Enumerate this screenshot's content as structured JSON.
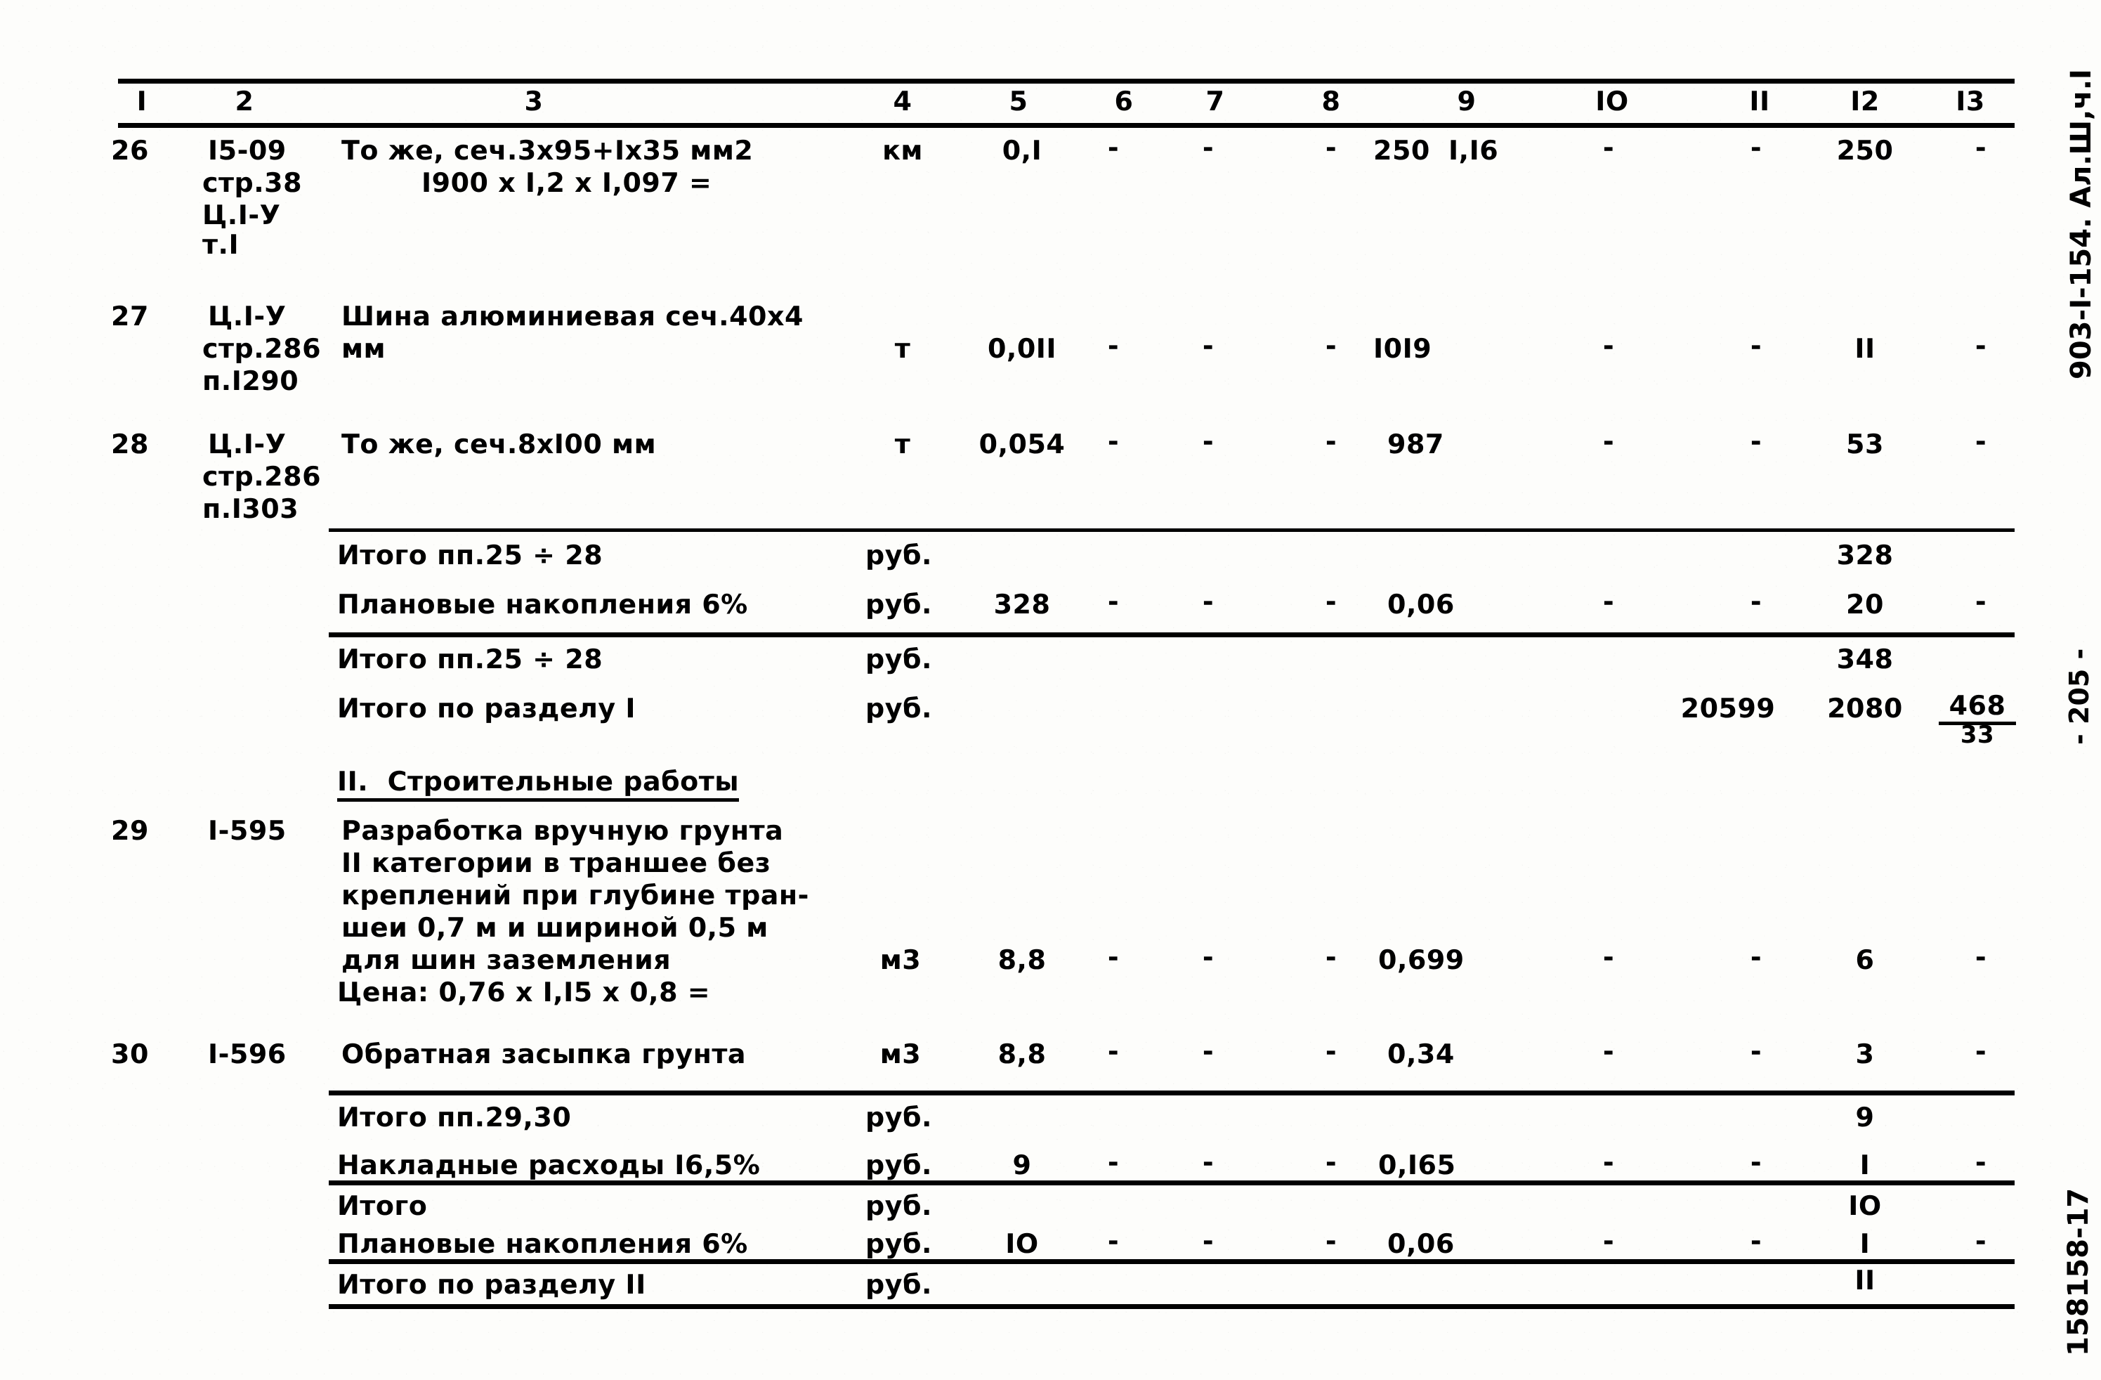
{
  "document": {
    "kind": "scanned-estimate-table",
    "language": "ru",
    "margin_marks": {
      "top_right": "903-I-154. Ал.Ш,ч.I",
      "page_number": "- 205 -",
      "bottom_right": "158158-17"
    }
  },
  "table": {
    "column_headers": [
      "I",
      "2",
      "3",
      "4",
      "5",
      "6",
      "7",
      "8",
      "9",
      "IO",
      "II",
      "I2",
      "I3"
    ],
    "rows": [
      {
        "type": "item",
        "num": "26",
        "code_lines": [
          "I5-09",
          "стр.38",
          "Ц.I-У",
          "т.I"
        ],
        "desc_lines": [
          "То же, сеч.3х95+Iх35 мм2",
          "I900 х I,2 х I,097 ="
        ],
        "unit": "км",
        "c5": "0,I",
        "c6": "-",
        "c7": "-",
        "c8": "-",
        "c9a": "250",
        "c9b": "I,I6",
        "c10": "-",
        "c11": "-",
        "c12": "250",
        "c13": "-"
      },
      {
        "type": "item",
        "num": "27",
        "code_lines": [
          "Ц.I-У",
          "стр.286",
          "п.I290"
        ],
        "desc_lines": [
          "Шина алюминиевая сеч.40х4",
          "мм"
        ],
        "unit": "т",
        "c5": "0,0II",
        "c6": "-",
        "c7": "-",
        "c8": "-",
        "c9a": "I0I9",
        "c9b": "",
        "c10": "-",
        "c11": "-",
        "c12": "II",
        "c13": "-"
      },
      {
        "type": "item",
        "num": "28",
        "code_lines": [
          "Ц.I-У",
          "стр.286",
          "п.I303"
        ],
        "desc_lines": [
          "То же, сеч.8хI00 мм"
        ],
        "unit": "т",
        "c5": "0,054",
        "c6": "-",
        "c7": "-",
        "c8": "-",
        "c9a": "987",
        "c9b": "",
        "c10": "-",
        "c11": "-",
        "c12": "53",
        "c13": "-"
      },
      {
        "type": "total",
        "label": "Итого пп.25 ÷ 28",
        "unit": "руб.",
        "c5": "",
        "c6": "",
        "c7": "",
        "c8": "",
        "c9a": "",
        "c10": "",
        "c11": "",
        "c12": "328",
        "c13": ""
      },
      {
        "type": "total",
        "label": "Плановые накопления 6%",
        "unit": "руб.",
        "c5": "328",
        "c6": "-",
        "c7": "-",
        "c8": "-",
        "c9a": "0,06",
        "c10": "-",
        "c11": "-",
        "c12": "20",
        "c13": "-"
      },
      {
        "type": "total",
        "label": "Итого пп.25 ÷ 28",
        "unit": "руб.",
        "c5": "",
        "c6": "",
        "c7": "",
        "c8": "",
        "c9a": "",
        "c10": "",
        "c11": "",
        "c12": "348",
        "c13": ""
      },
      {
        "type": "total",
        "label": "Итого по разделу I",
        "unit": "руб.",
        "c5": "",
        "c6": "",
        "c7": "",
        "c8": "",
        "c9a": "",
        "c10": "",
        "c11": "20599",
        "c12": "2080",
        "c13": "468",
        "c13b": "33"
      },
      {
        "type": "section",
        "label": "II.  Строительные работы"
      },
      {
        "type": "item",
        "num": "29",
        "code_lines": [
          "I-595"
        ],
        "desc_lines": [
          "Разработка вручную грунта",
          "II категории в траншее без",
          "креплений при глубине тран-",
          "шеи 0,7 м и шириной 0,5 м",
          "для шин заземления",
          "Цена: 0,76 х I,I5 х 0,8 ="
        ],
        "unit": "м3",
        "c5": "8,8",
        "c6": "-",
        "c7": "-",
        "c8": "-",
        "c9a": "0,699",
        "c9b": "",
        "c10": "-",
        "c11": "-",
        "c12": "6",
        "c13": "-"
      },
      {
        "type": "item",
        "num": "30",
        "code_lines": [
          "I-596"
        ],
        "desc_lines": [
          "Обратная засыпка грунта"
        ],
        "unit": "м3",
        "c5": "8,8",
        "c6": "-",
        "c7": "-",
        "c8": "-",
        "c9a": "0,34",
        "c9b": "",
        "c10": "-",
        "c11": "-",
        "c12": "3",
        "c13": "-"
      },
      {
        "type": "total",
        "label": "Итого пп.29,30",
        "unit": "руб.",
        "c5": "",
        "c6": "",
        "c7": "",
        "c8": "",
        "c9a": "",
        "c10": "",
        "c11": "",
        "c12": "9",
        "c13": ""
      },
      {
        "type": "total",
        "label": "Накладные расходы I6,5%",
        "unit": "руб.",
        "c5": "9",
        "c6": "-",
        "c7": "-",
        "c8": "-",
        "c9a": "0,I65",
        "c10": "-",
        "c11": "-",
        "c12": "I",
        "c13": "-"
      },
      {
        "type": "total",
        "label": "Итого",
        "unit": "руб.",
        "c5": "",
        "c6": "",
        "c7": "",
        "c8": "",
        "c9a": "",
        "c10": "",
        "c11": "",
        "c12": "IO",
        "c13": ""
      },
      {
        "type": "total",
        "label": "Плановые накопления 6%",
        "unit": "руб.",
        "c5": "IO",
        "c6": "-",
        "c7": "-",
        "c8": "-",
        "c9a": "0,06",
        "c10": "-",
        "c11": "-",
        "c12": "I",
        "c13": "-"
      },
      {
        "type": "total",
        "label": "Итого по разделу II",
        "unit": "руб.",
        "c5": "",
        "c6": "",
        "c7": "",
        "c8": "",
        "c9a": "",
        "c10": "",
        "c11": "",
        "c12": "II",
        "c13": ""
      }
    ]
  },
  "colors": {
    "ink": "#000000",
    "paper": "#fdfdfb"
  }
}
